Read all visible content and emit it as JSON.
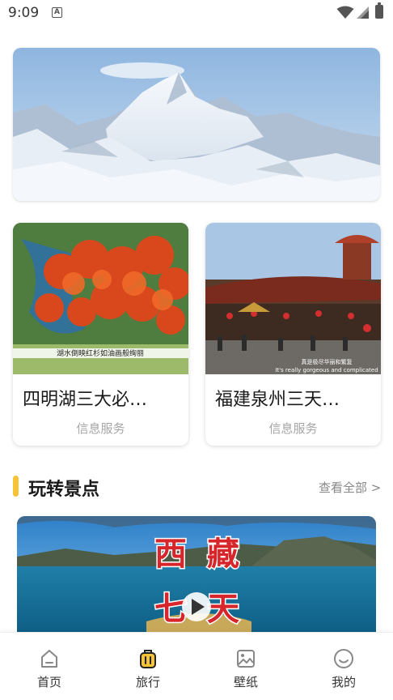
{
  "status_bar": {
    "time": "9:09",
    "notification_glyph": "A"
  },
  "banner": {
    "image": "snow-mountain-photo"
  },
  "cards": [
    {
      "title": "四明湖三大必…",
      "subtitle": "信息服务",
      "caption": "湖水倒映红杉如油画般绚丽",
      "image": "red-forest-lake-photo"
    },
    {
      "title": "福建泉州三天…",
      "subtitle": "信息服务",
      "caption": "真是极尽华丽和繁复",
      "caption_en": "It's really gorgeous and complicated",
      "image": "quanzhou-temple-photo"
    }
  ],
  "section": {
    "title": "玩转景点",
    "more": "查看全部 >",
    "accent_color": "#f7c337"
  },
  "feature": {
    "overlay_text": [
      "西",
      "藏",
      "七",
      "天"
    ],
    "image": "tibet-lake-photo"
  },
  "tabs": [
    {
      "label": "首页",
      "icon": "home-icon",
      "active": false
    },
    {
      "label": "旅行",
      "icon": "luggage-icon",
      "active": true
    },
    {
      "label": "壁纸",
      "icon": "image-icon",
      "active": false
    },
    {
      "label": "我的",
      "icon": "smile-icon",
      "active": false
    }
  ],
  "colors": {
    "accent": "#f7c337",
    "text": "#1a1a1a",
    "muted": "#a5a5a5"
  }
}
